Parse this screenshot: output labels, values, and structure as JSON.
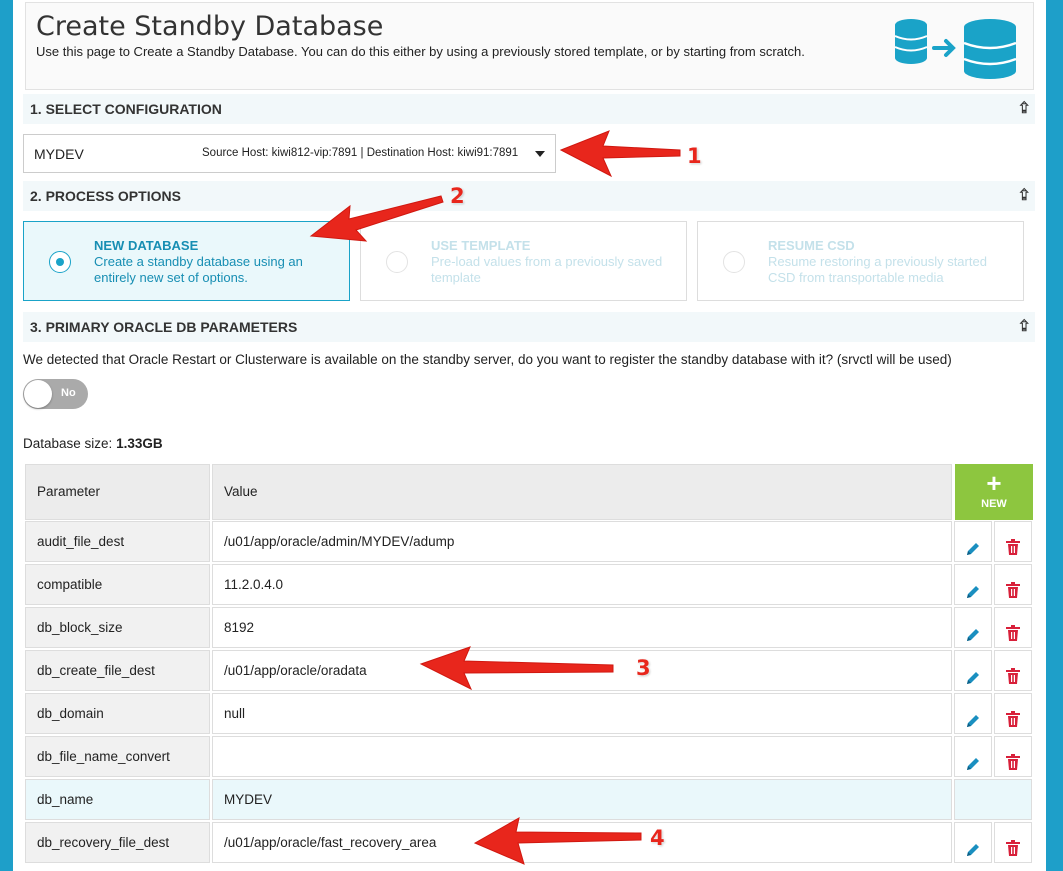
{
  "header": {
    "title": "Create Standby Database",
    "subtitle": "Use this page to Create a Standby Database. You can do this either by using a previously stored template, or by starting from scratch.",
    "icon": "database-transfer-icon"
  },
  "sections": {
    "s1": "1. SELECT CONFIGURATION",
    "s2": "2. PROCESS OPTIONS",
    "s3": "3. PRIMARY ORACLE DB PARAMETERS",
    "collapse_icon": "double-chevron-down-icon"
  },
  "config_select": {
    "name": "MYDEV",
    "detail": "Source Host: kiwi812-vip:7891 | Destination Host: kiwi91:7891"
  },
  "options": [
    {
      "title": "NEW DATABASE",
      "desc": "Create a standby database using an entirely new set of options.",
      "selected": true
    },
    {
      "title": "USE TEMPLATE",
      "desc": "Pre-load values from a previously saved template",
      "selected": false
    },
    {
      "title": "RESUME CSD",
      "desc": "Resume restoring a previously started CSD from transportable media",
      "selected": false
    }
  ],
  "detect_message": "We detected that Oracle Restart or Clusterware is available on the standby server, do you want to register the standby database with it? (srvctl will be used)",
  "toggle": {
    "label": "No",
    "on": false
  },
  "db_size": {
    "label": "Database size:",
    "value": "1.33GB"
  },
  "table": {
    "col_param": "Parameter",
    "col_value": "Value",
    "new_label": "NEW",
    "rows": [
      {
        "param": "audit_file_dest",
        "value": "/u01/app/oracle/admin/MYDEV/adump"
      },
      {
        "param": "compatible",
        "value": "11.2.0.4.0"
      },
      {
        "param": "db_block_size",
        "value": "8192"
      },
      {
        "param": "db_create_file_dest",
        "value": "/u01/app/oracle/oradata"
      },
      {
        "param": "db_domain",
        "value": "null"
      },
      {
        "param": "db_file_name_convert",
        "value": ""
      },
      {
        "param": "db_name",
        "value": "MYDEV"
      },
      {
        "param": "db_recovery_file_dest",
        "value": "/u01/app/oracle/fast_recovery_area"
      }
    ]
  },
  "annotations": [
    "1",
    "2",
    "3",
    "4"
  ],
  "colors": {
    "accent": "#1aa3c8",
    "new_button": "#8dc63f",
    "delete": "#d8203a",
    "arrow": "#e8261c"
  }
}
